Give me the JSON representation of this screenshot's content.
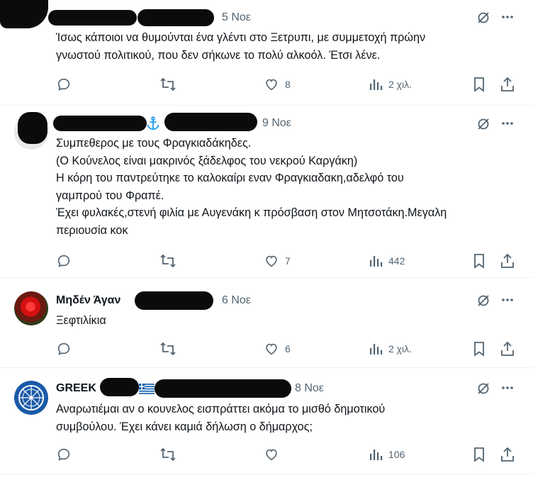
{
  "tweets": [
    {
      "date": "5 Νοε",
      "text": "Ίσως κάποιοι να θυμούνται ένα γλέντι στο Ξετρυπι, με συμμετοχή πρώην\nγνωστού πολιτικού, που δεν σήκωνε το πολύ αλκοόλ. Έτσι λένε.",
      "replies": "",
      "reposts": "",
      "likes": "8",
      "views": "2 χιλ."
    },
    {
      "date": "9 Νοε",
      "badge_icon": "anchor-icon",
      "text": "Συμπεθερος με τους Φραγκιαδάκηδες.\n(Ο Κούνελος είναι μακρινός ξάδελφος του νεκρού Καργάκη)\nΗ κόρη του παντρεύτηκε το καλοκαίρι εναν Φραγκιαδακη,αδελφό του\nγαμπρού του Φραπέ.\nΈχει φυλακές,στενή φιλία με Αυγενάκη κ πρόσβαση στον Μητσοτάκη.Μεγαλη\nπεριουσία κοκ",
      "replies": "",
      "reposts": "",
      "likes": "7",
      "views": "442"
    },
    {
      "name": "Μηδέν Άγαν",
      "date": "6 Νοε",
      "text": "Ξεφτιλίκια",
      "replies": "",
      "reposts": "",
      "likes": "6",
      "views": "2 χιλ."
    },
    {
      "name": "GREEK",
      "badge_icon": "greek-flag-icon",
      "date": "8 Νοε",
      "text": "Αναρωτιέμαι αν ο κουνελος εισπράττει ακόμα το μισθό δημοτικού\nσυμβούλου. Έχει κάνει καμιά δήλωση ο δήμαρχος;",
      "replies": "",
      "reposts": "",
      "likes": "",
      "views": "106"
    }
  ],
  "colors": {
    "text": "#0f1419",
    "secondary": "#536471",
    "divider": "#eff3f4",
    "anchor": "#1d9bf0",
    "redaction": "#0b0b0b"
  },
  "icons": [
    "reply-icon",
    "repost-icon",
    "like-icon",
    "views-icon",
    "bookmark-icon",
    "share-icon",
    "grok-icon",
    "more-icon"
  ]
}
